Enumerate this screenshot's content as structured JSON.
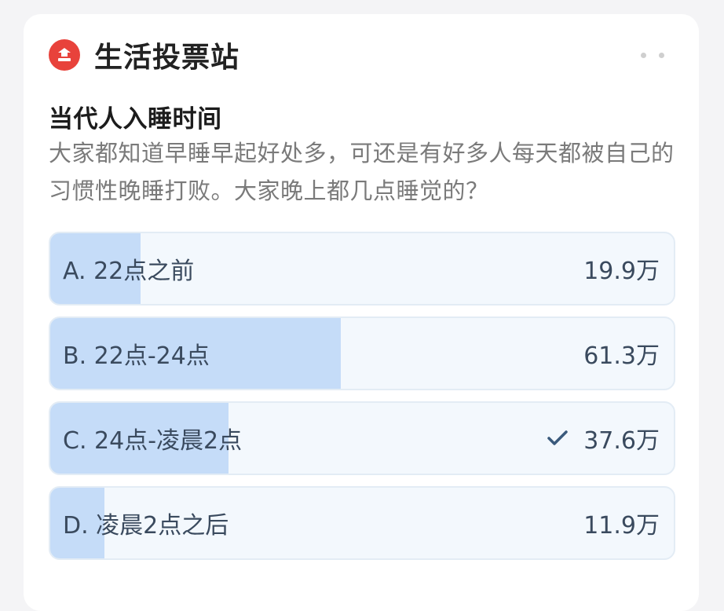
{
  "header": {
    "station_title": "生活投票站",
    "brand_color": "#e8423b"
  },
  "question": {
    "title": "当代人入睡时间",
    "description": "大家都知道早睡早起好处多，可还是有好多人每天都被自己的习惯性晚睡打败。大家晚上都几点睡觉的？"
  },
  "options": [
    {
      "label": "A. 22点之前",
      "count": "19.9万",
      "fill_fraction": 0.145,
      "selected": false
    },
    {
      "label": "B. 22点-24点",
      "count": "61.3万",
      "fill_fraction": 0.466,
      "selected": false
    },
    {
      "label": "C. 24点-凌晨2点",
      "count": "37.6万",
      "fill_fraction": 0.286,
      "selected": true
    },
    {
      "label": "D. 凌晨2点之后",
      "count": "11.9万",
      "fill_fraction": 0.087,
      "selected": false
    }
  ],
  "icons": {
    "brand": "vote-logo-icon",
    "more": "more-dots-icon",
    "check": "checkmark-icon"
  },
  "colors": {
    "bar_fill": "#c5dcf8",
    "option_bg": "#f3f8fd",
    "check": "#3a5a7c"
  }
}
